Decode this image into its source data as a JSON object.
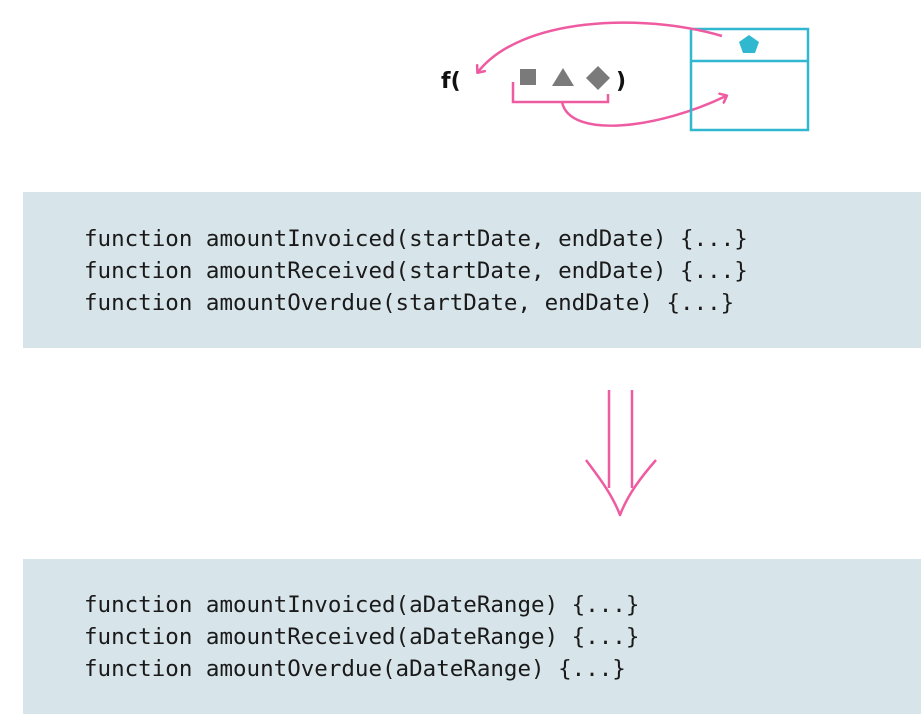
{
  "diagram": {
    "function_label": "f(",
    "close_paren": ")",
    "colors": {
      "arrow": "#ef5ba1",
      "object_box": "#2fb8d0",
      "pentagon": "#2fb8d0",
      "shapes": "#7a7a7a",
      "code_background": "#d7e4ea"
    },
    "icons": [
      "square-icon",
      "triangle-icon",
      "diamond-icon",
      "pentagon-icon"
    ]
  },
  "before": {
    "lines": [
      "function amountInvoiced(startDate, endDate) {...}",
      "function amountReceived(startDate, endDate) {...}",
      "function amountOverdue(startDate, endDate) {...}"
    ]
  },
  "after": {
    "lines": [
      "function amountInvoiced(aDateRange) {...}",
      "function amountReceived(aDateRange) {...}",
      "function amountOverdue(aDateRange) {...}"
    ]
  }
}
